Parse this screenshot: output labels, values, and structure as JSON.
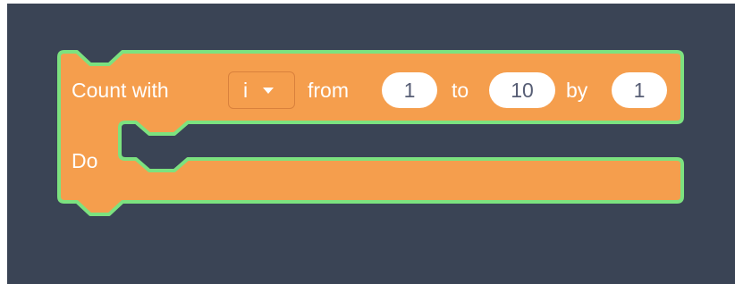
{
  "colors": {
    "workspace_background": "#3a4455",
    "block_fill": "#f59e4d",
    "block_outline": "#7ce27f",
    "text": "#ffffff",
    "input_fill": "#ffffff",
    "input_text": "#575e75"
  },
  "block": {
    "label_count_with": "Count with",
    "variable": "i",
    "label_from": "from",
    "from_value": "1",
    "label_to": "to",
    "to_value": "10",
    "label_by": "by",
    "by_value": "1",
    "label_do": "Do"
  },
  "icons": {
    "dropdown_caret": "caret-down-icon"
  }
}
